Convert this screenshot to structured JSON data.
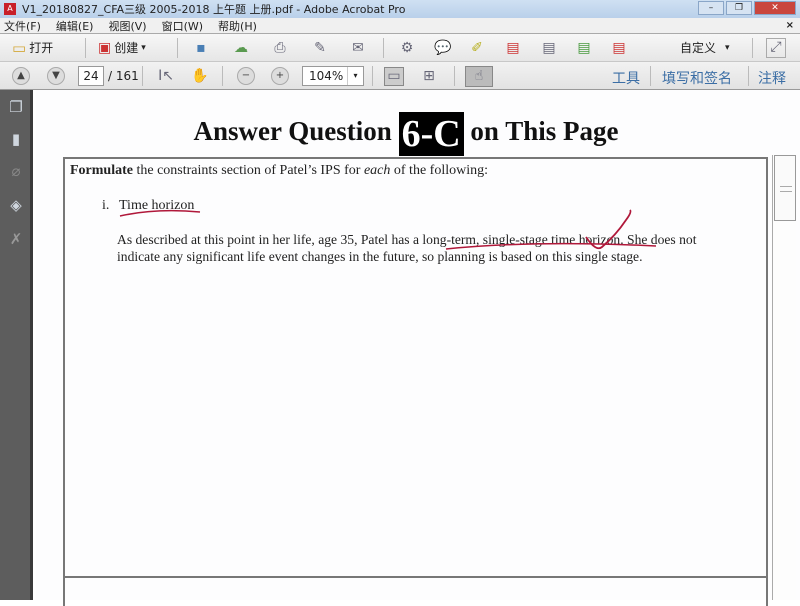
{
  "window": {
    "title": "V1_20180827_CFA三级 2005-2018 上午题  上册.pdf - Adobe Acrobat Pro",
    "minimize": "–",
    "restore": "❐",
    "close": "✕"
  },
  "menu": [
    "文件(F)",
    "编辑(E)",
    "视图(V)",
    "窗口(W)",
    "帮助(H)"
  ],
  "menu_close": "×",
  "toolbar": {
    "open": "打开",
    "create": "创建",
    "customize": "自定义",
    "dropdown": "▾"
  },
  "nav": {
    "page": "24",
    "total": "/ 161",
    "zoom": "104%"
  },
  "panels": [
    "工具",
    "填写和签名",
    "注释"
  ],
  "document": {
    "heading_pre": "Answer Question ",
    "heading_q": "6-C",
    "heading_post": " on This Page",
    "prompt_bold": "Formulate",
    "prompt_1": " the constraints section of Patel’s IPS for ",
    "prompt_em": "each",
    "prompt_2": " of the following:",
    "item_num": "i.",
    "item_label": "Time horizon",
    "answer_line1": "As described at this point in her life, age 35, Patel has a long-term, single-stage time horizon. She does not",
    "answer_line2": "indicate any significant life event changes in the future, so planning is based on this single stage."
  },
  "annotation_color": "#b0183a"
}
